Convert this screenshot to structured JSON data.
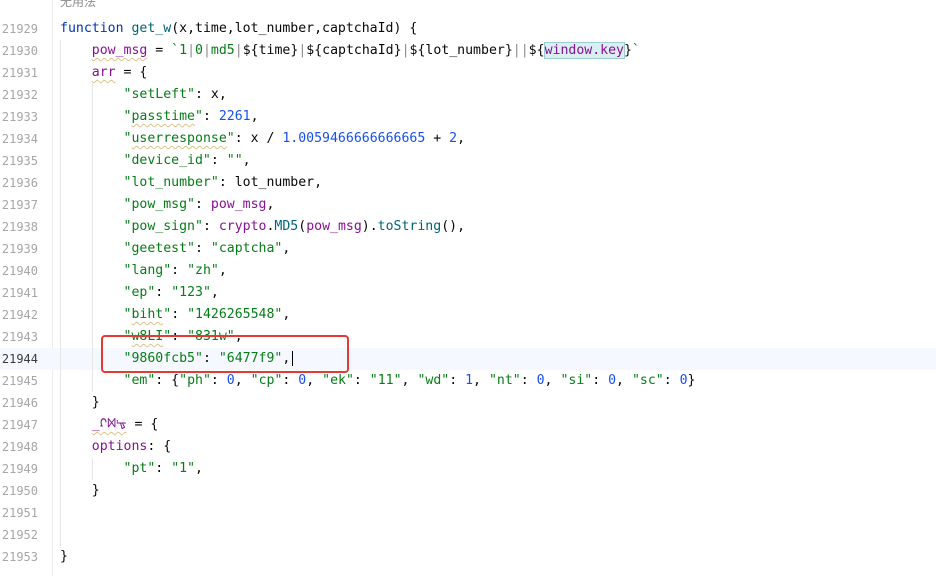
{
  "editor": {
    "hint_label": "无用法",
    "highlight_color": "#e53935"
  },
  "lines": [
    {
      "num": "21929",
      "text": "function get_w(x,time,lot_number,captchaId) {"
    },
    {
      "num": "21930",
      "text": "    pow_msg = `1|0|md5|${time}|${captchaId}|${lot_number}||${window.key}`"
    },
    {
      "num": "21931",
      "text": "    arr = {"
    },
    {
      "num": "21932",
      "text": "        \"setLeft\": x,"
    },
    {
      "num": "21933",
      "text": "        \"passtime\": 2261,"
    },
    {
      "num": "21934",
      "text": "        \"userresponse\": x / 1.0059466666666665 + 2,"
    },
    {
      "num": "21935",
      "text": "        \"device_id\": \"\","
    },
    {
      "num": "21936",
      "text": "        \"lot_number\": lot_number,"
    },
    {
      "num": "21937",
      "text": "        \"pow_msg\": pow_msg,"
    },
    {
      "num": "21938",
      "text": "        \"pow_sign\": crypto.MD5(pow_msg).toString(),"
    },
    {
      "num": "21939",
      "text": "        \"geetest\": \"captcha\","
    },
    {
      "num": "21940",
      "text": "        \"lang\": \"zh\","
    },
    {
      "num": "21941",
      "text": "        \"ep\": \"123\","
    },
    {
      "num": "21942",
      "text": "        \"biht\": \"1426265548\","
    },
    {
      "num": "21943",
      "text": "        \"w8LI\": \"831w\","
    },
    {
      "num": "21944",
      "text": "        \"9860fcb5\": \"6477f9\","
    },
    {
      "num": "21945",
      "text": "        \"em\": {\"ph\": 0, \"cp\": 0, \"ek\": \"11\", \"wd\": 1, \"nt\": 0, \"si\": 0, \"sc\": 0}"
    },
    {
      "num": "21946",
      "text": "    }"
    },
    {
      "num": "21947",
      "text": "    _ᡗᢂᡃᡑ = {"
    },
    {
      "num": "21948",
      "text": "    options: {"
    },
    {
      "num": "21949",
      "text": "        \"pt\": \"1\","
    },
    {
      "num": "21950",
      "text": "    }"
    },
    {
      "num": "21951",
      "text": ""
    },
    {
      "num": "21952",
      "text": ""
    },
    {
      "num": "21953",
      "text": "}"
    }
  ],
  "tokens": {
    "21929": [
      {
        "t": "function",
        "c": "k"
      },
      {
        "t": " ",
        "c": "p"
      },
      {
        "t": "get_w",
        "c": "f"
      },
      {
        "t": "(x,time,lot_number,captchaId) {",
        "c": "p"
      }
    ],
    "21930": [
      {
        "t": "    ",
        "c": "p"
      },
      {
        "t": "pow_msg",
        "c": "v",
        "sq": true
      },
      {
        "t": " = ",
        "c": "p"
      },
      {
        "t": "`1",
        "c": "s"
      },
      {
        "t": "|",
        "c": "t"
      },
      {
        "t": "0",
        "c": "s"
      },
      {
        "t": "|",
        "c": "t"
      },
      {
        "t": "md5",
        "c": "s"
      },
      {
        "t": "|",
        "c": "t"
      },
      {
        "t": "${",
        "c": "p"
      },
      {
        "t": "time",
        "c": "p"
      },
      {
        "t": "}",
        "c": "p"
      },
      {
        "t": "|",
        "c": "t"
      },
      {
        "t": "${",
        "c": "p"
      },
      {
        "t": "captchaId",
        "c": "p"
      },
      {
        "t": "}",
        "c": "p"
      },
      {
        "t": "|",
        "c": "t"
      },
      {
        "t": "${",
        "c": "p"
      },
      {
        "t": "lot_number",
        "c": "p"
      },
      {
        "t": "}",
        "c": "p"
      },
      {
        "t": "||",
        "c": "t"
      },
      {
        "t": "${",
        "c": "p"
      },
      {
        "t": "window.key",
        "c": "wkey"
      },
      {
        "t": "}",
        "c": "p"
      },
      {
        "t": "`",
        "c": "s"
      }
    ],
    "21931": [
      {
        "t": "    ",
        "c": "p"
      },
      {
        "t": "arr",
        "c": "v",
        "sq": true
      },
      {
        "t": " = {",
        "c": "p"
      }
    ],
    "21932": [
      {
        "t": "        ",
        "c": "p"
      },
      {
        "t": "\"setLeft\"",
        "c": "s"
      },
      {
        "t": ": x,",
        "c": "p"
      }
    ],
    "21933": [
      {
        "t": "        ",
        "c": "p"
      },
      {
        "t": "\"",
        "c": "s"
      },
      {
        "t": "passtime",
        "c": "s",
        "sq": true
      },
      {
        "t": "\"",
        "c": "s"
      },
      {
        "t": ": ",
        "c": "p"
      },
      {
        "t": "2261",
        "c": "n"
      },
      {
        "t": ",",
        "c": "p"
      }
    ],
    "21934": [
      {
        "t": "        ",
        "c": "p"
      },
      {
        "t": "\"",
        "c": "s"
      },
      {
        "t": "userresponse",
        "c": "s",
        "sq": true
      },
      {
        "t": "\"",
        "c": "s"
      },
      {
        "t": ": x / ",
        "c": "p"
      },
      {
        "t": "1.0059466666666665",
        "c": "n"
      },
      {
        "t": " + ",
        "c": "p"
      },
      {
        "t": "2",
        "c": "n"
      },
      {
        "t": ",",
        "c": "p"
      }
    ],
    "21935": [
      {
        "t": "        ",
        "c": "p"
      },
      {
        "t": "\"device_id\"",
        "c": "s"
      },
      {
        "t": ": ",
        "c": "p"
      },
      {
        "t": "\"\"",
        "c": "s"
      },
      {
        "t": ",",
        "c": "p"
      }
    ],
    "21936": [
      {
        "t": "        ",
        "c": "p"
      },
      {
        "t": "\"lot_number\"",
        "c": "s"
      },
      {
        "t": ": lot_number,",
        "c": "p"
      }
    ],
    "21937": [
      {
        "t": "        ",
        "c": "p"
      },
      {
        "t": "\"pow_msg\"",
        "c": "s"
      },
      {
        "t": ": ",
        "c": "p"
      },
      {
        "t": "pow_msg",
        "c": "v"
      },
      {
        "t": ",",
        "c": "p"
      }
    ],
    "21938": [
      {
        "t": "        ",
        "c": "p"
      },
      {
        "t": "\"pow_sign\"",
        "c": "s"
      },
      {
        "t": ": ",
        "c": "p"
      },
      {
        "t": "crypto",
        "c": "v"
      },
      {
        "t": ".",
        "c": "p"
      },
      {
        "t": "MD5",
        "c": "m"
      },
      {
        "t": "(",
        "c": "p"
      },
      {
        "t": "pow_msg",
        "c": "v"
      },
      {
        "t": ").",
        "c": "p"
      },
      {
        "t": "toString",
        "c": "m"
      },
      {
        "t": "(),",
        "c": "p"
      }
    ],
    "21939": [
      {
        "t": "        ",
        "c": "p"
      },
      {
        "t": "\"geetest\"",
        "c": "s"
      },
      {
        "t": ": ",
        "c": "p"
      },
      {
        "t": "\"captcha\"",
        "c": "s"
      },
      {
        "t": ",",
        "c": "p"
      }
    ],
    "21940": [
      {
        "t": "        ",
        "c": "p"
      },
      {
        "t": "\"lang\"",
        "c": "s"
      },
      {
        "t": ": ",
        "c": "p"
      },
      {
        "t": "\"zh\"",
        "c": "s"
      },
      {
        "t": ",",
        "c": "p"
      }
    ],
    "21941": [
      {
        "t": "        ",
        "c": "p"
      },
      {
        "t": "\"ep\"",
        "c": "s"
      },
      {
        "t": ": ",
        "c": "p"
      },
      {
        "t": "\"123\"",
        "c": "s"
      },
      {
        "t": ",",
        "c": "p"
      }
    ],
    "21942": [
      {
        "t": "        ",
        "c": "p"
      },
      {
        "t": "\"",
        "c": "s"
      },
      {
        "t": "biht",
        "c": "s",
        "sq": true
      },
      {
        "t": "\"",
        "c": "s"
      },
      {
        "t": ": ",
        "c": "p"
      },
      {
        "t": "\"1426265548\"",
        "c": "s"
      },
      {
        "t": ",",
        "c": "p"
      }
    ],
    "21943": [
      {
        "t": "        ",
        "c": "p"
      },
      {
        "t": "\"",
        "c": "s"
      },
      {
        "t": "w8LI",
        "c": "s",
        "sq": true
      },
      {
        "t": "\"",
        "c": "s"
      },
      {
        "t": ": ",
        "c": "p"
      },
      {
        "t": "\"831w\"",
        "c": "s"
      },
      {
        "t": ",",
        "c": "p"
      }
    ],
    "21944": [
      {
        "t": "        ",
        "c": "p"
      },
      {
        "t": "\"9860fcb5\"",
        "c": "s"
      },
      {
        "t": ": ",
        "c": "p"
      },
      {
        "t": "\"6477f9\"",
        "c": "s"
      },
      {
        "t": ",",
        "c": "p"
      }
    ],
    "21945": [
      {
        "t": "        ",
        "c": "p"
      },
      {
        "t": "\"em\"",
        "c": "s"
      },
      {
        "t": ": {",
        "c": "p"
      },
      {
        "t": "\"ph\"",
        "c": "s"
      },
      {
        "t": ": ",
        "c": "p"
      },
      {
        "t": "0",
        "c": "n"
      },
      {
        "t": ", ",
        "c": "p"
      },
      {
        "t": "\"cp\"",
        "c": "s"
      },
      {
        "t": ": ",
        "c": "p"
      },
      {
        "t": "0",
        "c": "n"
      },
      {
        "t": ", ",
        "c": "p"
      },
      {
        "t": "\"ek\"",
        "c": "s"
      },
      {
        "t": ": ",
        "c": "p"
      },
      {
        "t": "\"11\"",
        "c": "s"
      },
      {
        "t": ", ",
        "c": "p"
      },
      {
        "t": "\"wd\"",
        "c": "s"
      },
      {
        "t": ": ",
        "c": "p"
      },
      {
        "t": "1",
        "c": "n"
      },
      {
        "t": ", ",
        "c": "p"
      },
      {
        "t": "\"nt\"",
        "c": "s"
      },
      {
        "t": ": ",
        "c": "p"
      },
      {
        "t": "0",
        "c": "n"
      },
      {
        "t": ", ",
        "c": "p"
      },
      {
        "t": "\"si\"",
        "c": "s"
      },
      {
        "t": ": ",
        "c": "p"
      },
      {
        "t": "0",
        "c": "n"
      },
      {
        "t": ", ",
        "c": "p"
      },
      {
        "t": "\"sc\"",
        "c": "s"
      },
      {
        "t": ": ",
        "c": "p"
      },
      {
        "t": "0",
        "c": "n"
      },
      {
        "t": "}",
        "c": "p"
      }
    ],
    "21946": [
      {
        "t": "    }",
        "c": "p"
      }
    ],
    "21947": [
      {
        "t": "    ",
        "c": "p"
      },
      {
        "t": "_ᡗᢂᡃᡑ",
        "c": "v",
        "sq": true
      },
      {
        "t": " = {",
        "c": "p"
      }
    ],
    "21948": [
      {
        "t": "    ",
        "c": "p"
      },
      {
        "t": "options",
        "c": "v"
      },
      {
        "t": ": {",
        "c": "p"
      }
    ],
    "21949": [
      {
        "t": "        ",
        "c": "p"
      },
      {
        "t": "\"pt\"",
        "c": "s"
      },
      {
        "t": ": ",
        "c": "p"
      },
      {
        "t": "\"1\"",
        "c": "s"
      },
      {
        "t": ",",
        "c": "p"
      }
    ],
    "21950": [
      {
        "t": "    }",
        "c": "p"
      }
    ],
    "21951": [],
    "21952": [],
    "21953": [
      {
        "t": "}",
        "c": "p"
      }
    ]
  },
  "current_line": "21944"
}
